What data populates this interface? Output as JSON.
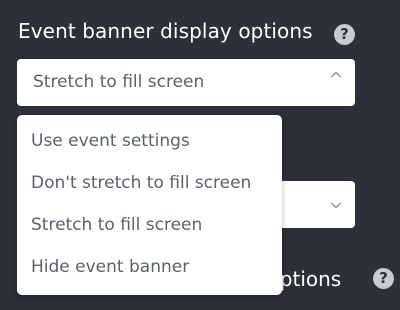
{
  "section": {
    "title": "Event banner display options",
    "help_glyph": "?"
  },
  "banner_select": {
    "value": "Stretch to fill screen",
    "chevron_icon": "chevron-up-icon"
  },
  "dropdown": {
    "options": [
      {
        "label": "Use event settings"
      },
      {
        "label": "Don't stretch to fill screen"
      },
      {
        "label": "Stretch to fill screen"
      },
      {
        "label": "Hide event banner"
      }
    ]
  },
  "second_select": {
    "value": "",
    "chevron_icon": "chevron-down-icon"
  },
  "next_section": {
    "title_visible_fragment": "riptions",
    "help_glyph": "?"
  },
  "colors": {
    "background": "#2d3039",
    "text_light": "#ffffff",
    "option_text": "#5b6070",
    "help_icon_bg": "#c9cbd2"
  }
}
